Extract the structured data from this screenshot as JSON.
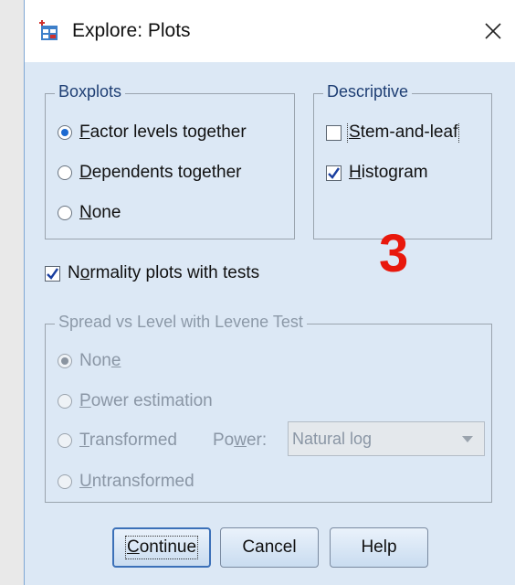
{
  "window": {
    "title": "Explore: Plots",
    "close_glyph": "✕",
    "app_icon": "spss-table-icon"
  },
  "boxplots": {
    "legend": "Boxplots",
    "options": [
      {
        "prefix": "",
        "mnemonic": "F",
        "rest": "actor levels together",
        "selected": true
      },
      {
        "prefix": "",
        "mnemonic": "D",
        "rest": "ependents together",
        "selected": false
      },
      {
        "prefix": "",
        "mnemonic": "N",
        "rest": "one",
        "selected": false
      }
    ]
  },
  "descriptive": {
    "legend": "Descriptive",
    "stem": {
      "mnemonic": "S",
      "rest": "tem-and-leaf",
      "checked": false
    },
    "histogram": {
      "mnemonic": "H",
      "rest": "istogram",
      "checked": true
    }
  },
  "annotation": "3",
  "normality": {
    "prefix": "N",
    "mnemonic": "o",
    "rest": "rmality plots with tests",
    "checked": true
  },
  "spread": {
    "legend": "Spread vs Level with Levene Test",
    "none": {
      "prefix": "Non",
      "mnemonic": "e",
      "rest": "",
      "selected": true
    },
    "power_est": {
      "prefix": "",
      "mnemonic": "P",
      "rest": "ower estimation",
      "selected": false
    },
    "transformed": {
      "prefix": "",
      "mnemonic": "T",
      "rest": "ransformed",
      "selected": false
    },
    "power_label": {
      "prefix": "Po",
      "mnemonic": "w",
      "rest": "er:"
    },
    "power_value": "Natural log",
    "untransformed": {
      "prefix": "",
      "mnemonic": "U",
      "rest": "ntransformed",
      "selected": false
    }
  },
  "buttons": {
    "continue": {
      "mnemonic": "C",
      "rest": "ontinue"
    },
    "cancel": "Cancel",
    "help": "Help"
  },
  "colors": {
    "dialog_bg": "#dce8f5",
    "accent": "#1d6ad1",
    "annotation": "#e8180c"
  }
}
